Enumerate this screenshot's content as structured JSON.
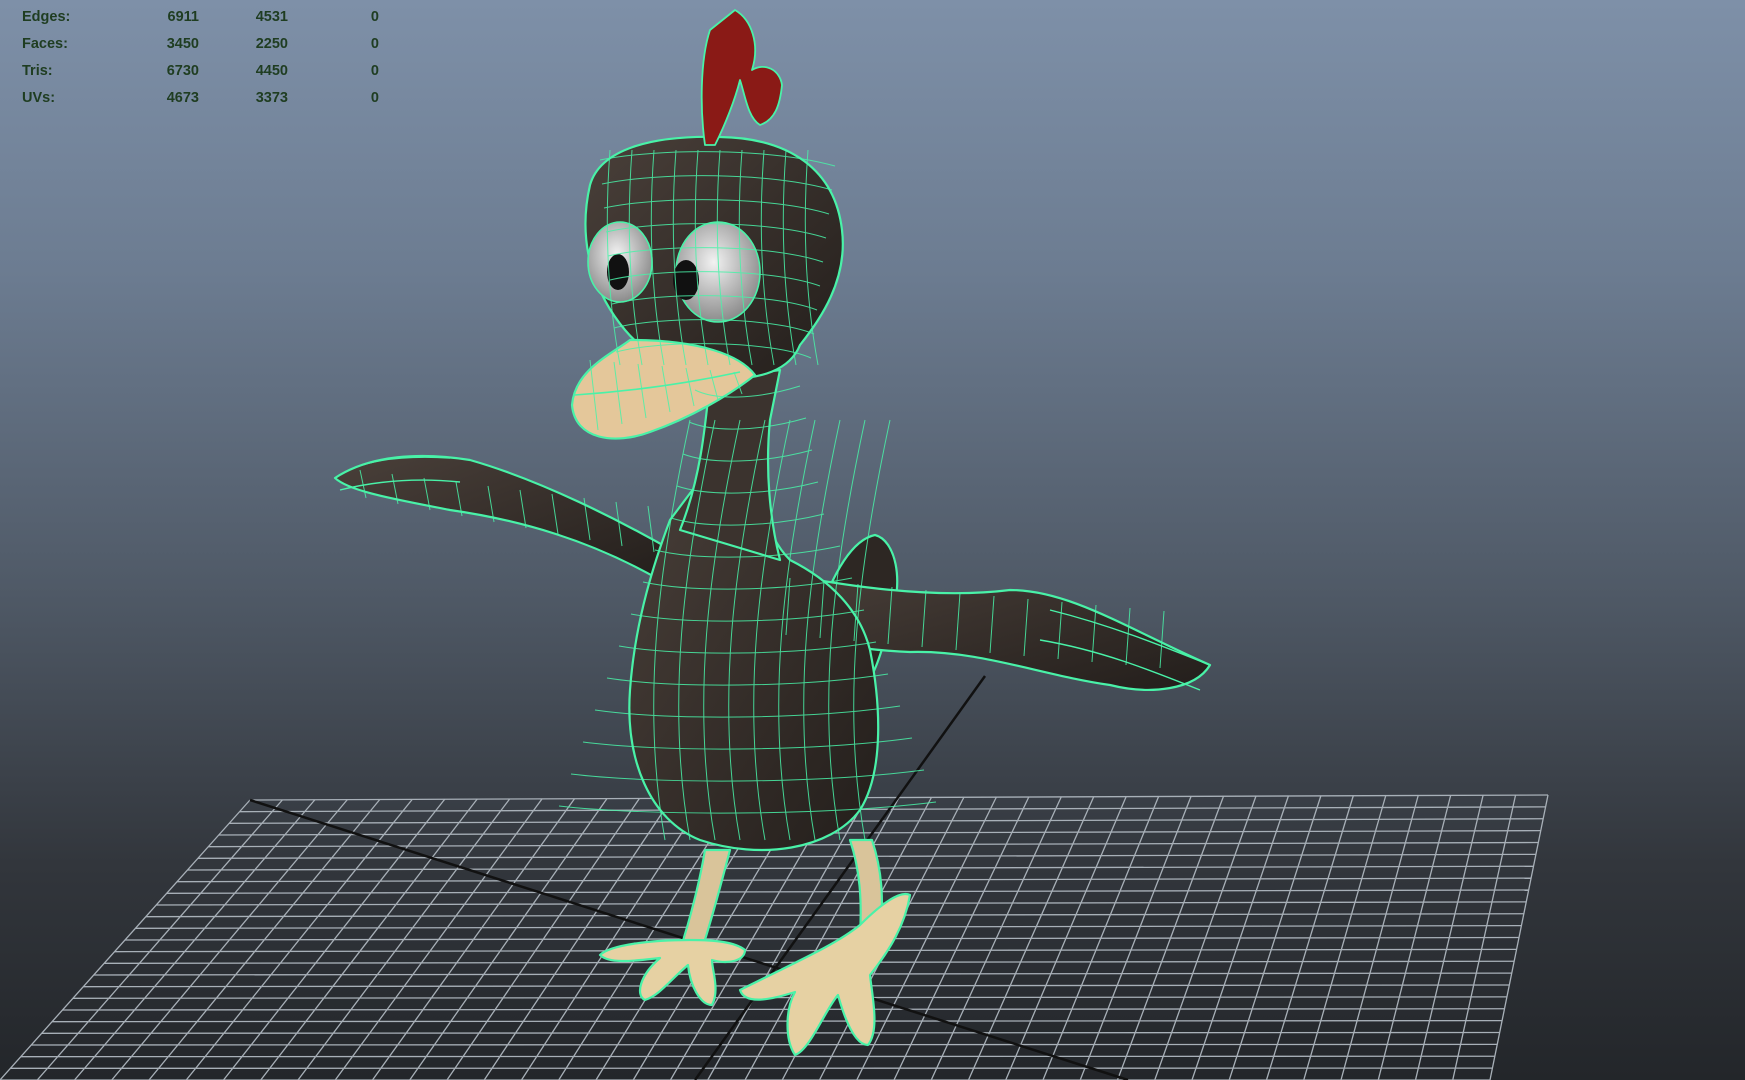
{
  "viewport": {
    "name": "perspective-viewport"
  },
  "heads_up_display": {
    "rows": [
      {
        "label": "Edges:",
        "values": [
          "6911",
          "4531",
          "0"
        ]
      },
      {
        "label": "Faces:",
        "values": [
          "3450",
          "2250",
          "0"
        ]
      },
      {
        "label": "Tris:",
        "values": [
          "6730",
          "4450",
          "0"
        ]
      },
      {
        "label": "UVs:",
        "values": [
          "4673",
          "3373",
          "0"
        ]
      }
    ],
    "text_color": "#1f3d21"
  },
  "colors": {
    "wireframe": "#49f2a8",
    "body": "#3a322d",
    "beak": "#e4c79a",
    "comb": "#8a1a16",
    "grid": "#a8b0b8",
    "grid_axis": "#111111"
  }
}
